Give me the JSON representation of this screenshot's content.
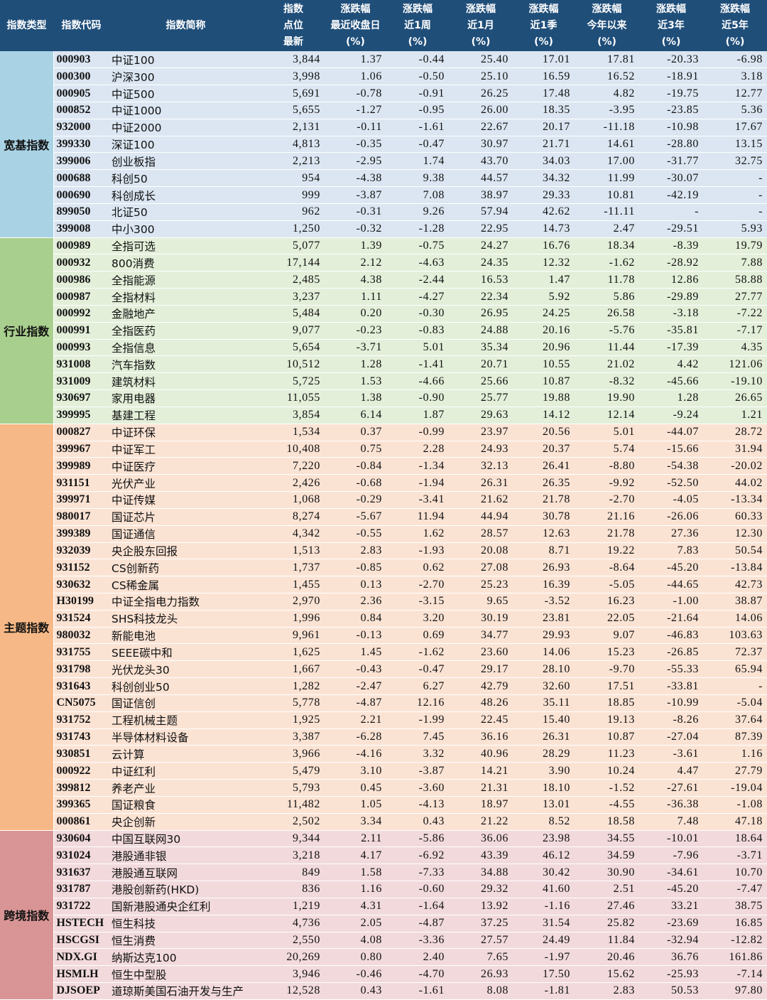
{
  "header": {
    "category": "指数类型",
    "code": "指数代码",
    "name": "指数简称",
    "level": [
      "指数",
      "点位",
      "最新"
    ],
    "chg_day": [
      "涨跌幅",
      "最近收盘日",
      "(%)"
    ],
    "chg_week": [
      "涨跌幅",
      "近1周",
      "(%)"
    ],
    "chg_month": [
      "涨跌幅",
      "近1月",
      "(%)"
    ],
    "chg_quarter": [
      "涨跌幅",
      "近1季",
      "(%)"
    ],
    "chg_ytd": [
      "涨跌幅",
      "今年以来",
      "(%)"
    ],
    "chg_3y": [
      "涨跌幅",
      "近3年",
      "(%)"
    ],
    "chg_5y": [
      "涨跌幅",
      "近5年",
      "(%)"
    ]
  },
  "groups": [
    {
      "label": "宽基指数",
      "theme": "broad",
      "rows": [
        [
          "000903",
          "中证100",
          "3,844",
          "1.37",
          "-0.44",
          "25.40",
          "17.01",
          "17.81",
          "-20.33",
          "-6.98"
        ],
        [
          "000300",
          "沪深300",
          "3,998",
          "1.06",
          "-0.50",
          "25.10",
          "16.59",
          "16.52",
          "-18.91",
          "3.18"
        ],
        [
          "000905",
          "中证500",
          "5,691",
          "-0.78",
          "-0.91",
          "26.25",
          "17.48",
          "4.82",
          "-19.75",
          "12.77"
        ],
        [
          "000852",
          "中证1000",
          "5,655",
          "-1.27",
          "-0.95",
          "26.00",
          "18.35",
          "-3.95",
          "-23.85",
          "5.36"
        ],
        [
          "932000",
          "中证2000",
          "2,131",
          "-0.11",
          "-1.61",
          "22.67",
          "20.17",
          "-11.18",
          "-10.98",
          "17.67"
        ],
        [
          "399330",
          "深证100",
          "4,813",
          "-0.35",
          "-0.47",
          "30.97",
          "21.71",
          "14.61",
          "-28.80",
          "13.15"
        ],
        [
          "399006",
          "创业板指",
          "2,213",
          "-2.95",
          "1.74",
          "43.70",
          "34.03",
          "17.00",
          "-31.77",
          "32.75"
        ],
        [
          "000688",
          "科创50",
          "954",
          "-4.38",
          "9.38",
          "44.57",
          "34.32",
          "11.99",
          "-30.07",
          "-"
        ],
        [
          "000690",
          "科创成长",
          "999",
          "-3.87",
          "7.08",
          "38.97",
          "29.33",
          "10.81",
          "-42.19",
          "-"
        ],
        [
          "899050",
          "北证50",
          "962",
          "-0.31",
          "9.26",
          "57.94",
          "42.62",
          "-11.11",
          "-",
          "-"
        ],
        [
          "399008",
          "中小300",
          "1,250",
          "-0.32",
          "-1.28",
          "22.95",
          "14.73",
          "2.47",
          "-29.51",
          "5.93"
        ]
      ]
    },
    {
      "label": "行业指数",
      "theme": "industry",
      "rows": [
        [
          "000989",
          "全指可选",
          "5,077",
          "1.39",
          "-0.75",
          "24.27",
          "16.76",
          "18.34",
          "-8.39",
          "19.79"
        ],
        [
          "000932",
          "800消费",
          "17,144",
          "2.12",
          "-4.63",
          "24.35",
          "12.32",
          "-1.62",
          "-28.92",
          "7.88"
        ],
        [
          "000986",
          "全指能源",
          "2,485",
          "4.38",
          "-2.44",
          "16.53",
          "1.47",
          "11.78",
          "12.86",
          "58.88"
        ],
        [
          "000987",
          "全指材料",
          "3,237",
          "1.11",
          "-4.27",
          "22.34",
          "5.92",
          "5.86",
          "-29.89",
          "27.77"
        ],
        [
          "000992",
          "金融地产",
          "5,484",
          "0.20",
          "-0.30",
          "26.95",
          "24.25",
          "26.58",
          "-3.18",
          "-7.22"
        ],
        [
          "000991",
          "全指医药",
          "9,077",
          "-0.23",
          "-0.83",
          "24.88",
          "20.16",
          "-5.76",
          "-35.81",
          "-7.17"
        ],
        [
          "000993",
          "全指信息",
          "5,654",
          "-3.71",
          "5.01",
          "35.34",
          "20.96",
          "11.44",
          "-17.39",
          "4.35"
        ],
        [
          "931008",
          "汽车指数",
          "10,512",
          "1.28",
          "-1.41",
          "20.71",
          "10.55",
          "21.02",
          "4.42",
          "121.06"
        ],
        [
          "931009",
          "建筑材料",
          "5,725",
          "1.53",
          "-4.66",
          "25.66",
          "10.87",
          "-8.32",
          "-45.66",
          "-19.10"
        ],
        [
          "930697",
          "家用电器",
          "11,055",
          "1.38",
          "-0.90",
          "25.77",
          "19.88",
          "19.90",
          "1.28",
          "26.65"
        ],
        [
          "399995",
          "基建工程",
          "3,854",
          "6.14",
          "1.87",
          "29.63",
          "14.12",
          "12.14",
          "-9.24",
          "1.21"
        ]
      ]
    },
    {
      "label": "主题指数",
      "theme": "theme",
      "rows": [
        [
          "000827",
          "中证环保",
          "1,534",
          "0.37",
          "-0.99",
          "23.97",
          "20.56",
          "5.01",
          "-44.07",
          "28.72"
        ],
        [
          "399967",
          "中证军工",
          "10,408",
          "0.75",
          "2.28",
          "24.93",
          "20.37",
          "5.74",
          "-15.66",
          "31.94"
        ],
        [
          "399989",
          "中证医疗",
          "7,220",
          "-0.84",
          "-1.34",
          "32.13",
          "26.41",
          "-8.80",
          "-54.38",
          "-20.02"
        ],
        [
          "931151",
          "光伏产业",
          "2,426",
          "-0.68",
          "-1.94",
          "26.31",
          "26.35",
          "-9.92",
          "-52.50",
          "44.02"
        ],
        [
          "399971",
          "中证传媒",
          "1,068",
          "-0.29",
          "-3.41",
          "21.62",
          "21.78",
          "-2.70",
          "-4.05",
          "-13.34"
        ],
        [
          "980017",
          "国证芯片",
          "8,274",
          "-5.67",
          "11.94",
          "44.94",
          "30.78",
          "21.16",
          "-26.06",
          "60.33"
        ],
        [
          "399389",
          "国证通信",
          "4,342",
          "-0.55",
          "1.62",
          "28.57",
          "12.63",
          "21.78",
          "27.36",
          "12.30"
        ],
        [
          "932039",
          "央企股东回报",
          "1,513",
          "2.83",
          "-1.93",
          "20.08",
          "8.71",
          "19.22",
          "7.83",
          "50.54"
        ],
        [
          "931152",
          "CS创新药",
          "1,737",
          "-0.85",
          "0.62",
          "27.08",
          "26.93",
          "-8.64",
          "-45.20",
          "-13.84"
        ],
        [
          "930632",
          "CS稀金属",
          "1,455",
          "0.13",
          "-2.70",
          "25.23",
          "16.39",
          "-5.05",
          "-44.65",
          "42.73"
        ],
        [
          "H30199",
          "中证全指电力指数",
          "2,970",
          "2.36",
          "-3.15",
          "9.65",
          "-3.52",
          "16.23",
          "-1.00",
          "38.87"
        ],
        [
          "931524",
          "SHS科技龙头",
          "1,996",
          "0.84",
          "3.20",
          "30.19",
          "23.81",
          "22.05",
          "-21.64",
          "14.06"
        ],
        [
          "980032",
          "新能电池",
          "9,961",
          "-0.13",
          "0.69",
          "34.77",
          "29.93",
          "9.07",
          "-46.83",
          "103.63"
        ],
        [
          "931755",
          "SEEE碳中和",
          "1,625",
          "1.45",
          "-1.62",
          "23.60",
          "14.06",
          "15.23",
          "-26.85",
          "72.37"
        ],
        [
          "931798",
          "光伏龙头30",
          "1,667",
          "-0.43",
          "-0.47",
          "29.17",
          "28.10",
          "-9.70",
          "-55.33",
          "65.94"
        ],
        [
          "931643",
          "科创创业50",
          "1,282",
          "-2.47",
          "6.27",
          "42.79",
          "32.60",
          "17.51",
          "-33.81",
          "-"
        ],
        [
          "CN5075",
          "国证信创",
          "5,778",
          "-4.87",
          "12.16",
          "48.26",
          "35.11",
          "18.85",
          "-10.99",
          "-5.04"
        ],
        [
          "931752",
          "工程机械主题",
          "1,925",
          "2.21",
          "-1.99",
          "22.45",
          "15.40",
          "19.13",
          "-8.26",
          "37.64"
        ],
        [
          "931743",
          "半导体材料设备",
          "3,387",
          "-6.28",
          "7.45",
          "36.16",
          "26.31",
          "10.87",
          "-27.04",
          "87.39"
        ],
        [
          "930851",
          "云计算",
          "3,966",
          "-4.16",
          "3.32",
          "40.96",
          "28.29",
          "11.23",
          "-3.61",
          "1.16"
        ],
        [
          "000922",
          "中证红利",
          "5,479",
          "3.10",
          "-3.87",
          "14.21",
          "3.90",
          "10.24",
          "4.47",
          "27.79"
        ],
        [
          "399812",
          "养老产业",
          "5,793",
          "0.45",
          "-3.60",
          "21.31",
          "18.10",
          "-1.52",
          "-27.61",
          "-19.04"
        ],
        [
          "399365",
          "国证粮食",
          "11,482",
          "1.05",
          "-4.13",
          "18.97",
          "13.01",
          "-4.55",
          "-36.38",
          "-1.08"
        ],
        [
          "000861",
          "央企创新",
          "2,502",
          "3.34",
          "0.43",
          "21.22",
          "8.52",
          "18.58",
          "7.48",
          "47.18"
        ]
      ]
    },
    {
      "label": "跨境指数",
      "theme": "cross",
      "rows": [
        [
          "930604",
          "中国互联网30",
          "9,344",
          "2.11",
          "-5.86",
          "36.06",
          "23.98",
          "34.55",
          "-10.01",
          "18.64"
        ],
        [
          "931024",
          "港股通非银",
          "3,218",
          "4.17",
          "-6.92",
          "43.39",
          "46.12",
          "34.59",
          "-7.96",
          "-3.71"
        ],
        [
          "931637",
          "港股通互联网",
          "849",
          "1.58",
          "-7.33",
          "34.88",
          "30.42",
          "30.90",
          "-34.61",
          "10.70"
        ],
        [
          "931787",
          "港股创新药(HKD)",
          "836",
          "1.16",
          "-0.60",
          "29.32",
          "41.60",
          "2.51",
          "-45.20",
          "-7.47"
        ],
        [
          "931722",
          "国新港股通央企红利",
          "1,219",
          "4.31",
          "-1.64",
          "13.92",
          "-1.16",
          "27.46",
          "33.21",
          "38.75"
        ],
        [
          "HSTECH",
          "恒生科技",
          "4,736",
          "2.05",
          "-4.87",
          "37.25",
          "31.54",
          "25.82",
          "-23.69",
          "16.85"
        ],
        [
          "HSCGSI",
          "恒生消费",
          "2,550",
          "4.08",
          "-3.36",
          "27.57",
          "24.49",
          "11.84",
          "-32.94",
          "-12.82"
        ],
        [
          "NDX.GI",
          "纳斯达克100",
          "20,269",
          "0.80",
          "2.40",
          "7.65",
          "-1.97",
          "20.46",
          "36.76",
          "161.86"
        ],
        [
          "HSMI.H",
          "恒生中型股",
          "3,946",
          "-0.46",
          "-4.70",
          "26.93",
          "17.50",
          "15.62",
          "-25.93",
          "-7.14"
        ],
        [
          "DJSOEP",
          "道琼斯美国石油开发与生产",
          "12,528",
          "0.43",
          "-1.61",
          "8.08",
          "-1.81",
          "2.83",
          "50.53",
          "97.80"
        ]
      ]
    }
  ]
}
